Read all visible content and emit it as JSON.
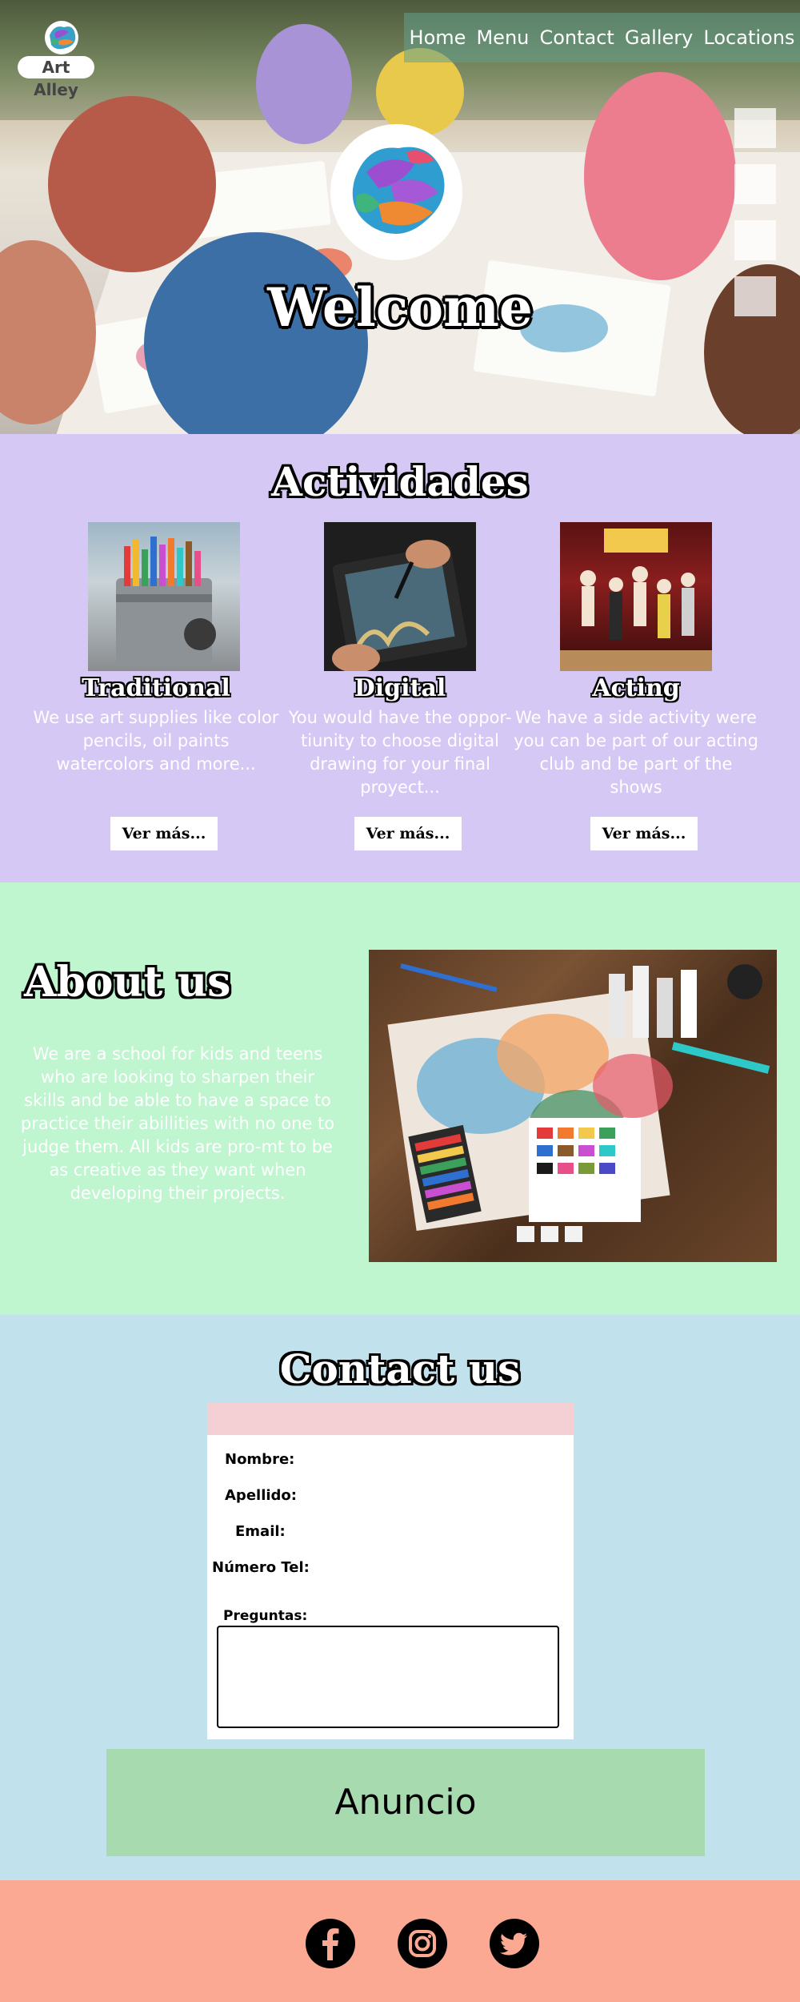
{
  "brand": {
    "logo_text": "Art Alley"
  },
  "nav": {
    "items": [
      "Home",
      "Menu",
      "Contact",
      "Gallery",
      "Locations"
    ]
  },
  "hero": {
    "title": "Welcome"
  },
  "activities": {
    "title": "Actividades",
    "items": [
      {
        "name": "Traditional",
        "desc": "We use art supplies like color pencils, oil paints watercolors and more...",
        "button": "Ver más..."
      },
      {
        "name": "Digital",
        "desc": "You would have the oppor-tiunity to choose digital drawing for your final proyect...",
        "button": "Ver más..."
      },
      {
        "name": "Acting",
        "desc": "We have a side activity were you can be part of our acting club and be part of the shows",
        "button": "Ver más..."
      }
    ]
  },
  "about": {
    "title": "About us",
    "text": "We are a school for kids and teens who are looking to sharpen their skills and be able to have a space to practice their abillities with no one to judge them. All kids are pro-mt to be as creative as they want when developing their projects."
  },
  "contact": {
    "title": "Contact us",
    "fields": {
      "nombre": "Nombre:",
      "apellido": "Apellido:",
      "email": "Email:",
      "tel": "Número Tel:",
      "preguntas": "Preguntas:"
    },
    "ad": "Anuncio"
  },
  "colors": {
    "activities_bg": "#d6c8f4",
    "about_bg": "#bff6cf",
    "contact_bg": "#c1e1ec",
    "footer_bg": "#fba993",
    "ad_bg": "#a8dab0",
    "form_header": "#f4cfd3"
  },
  "social": [
    "facebook-icon",
    "instagram-icon",
    "twitter-icon"
  ]
}
